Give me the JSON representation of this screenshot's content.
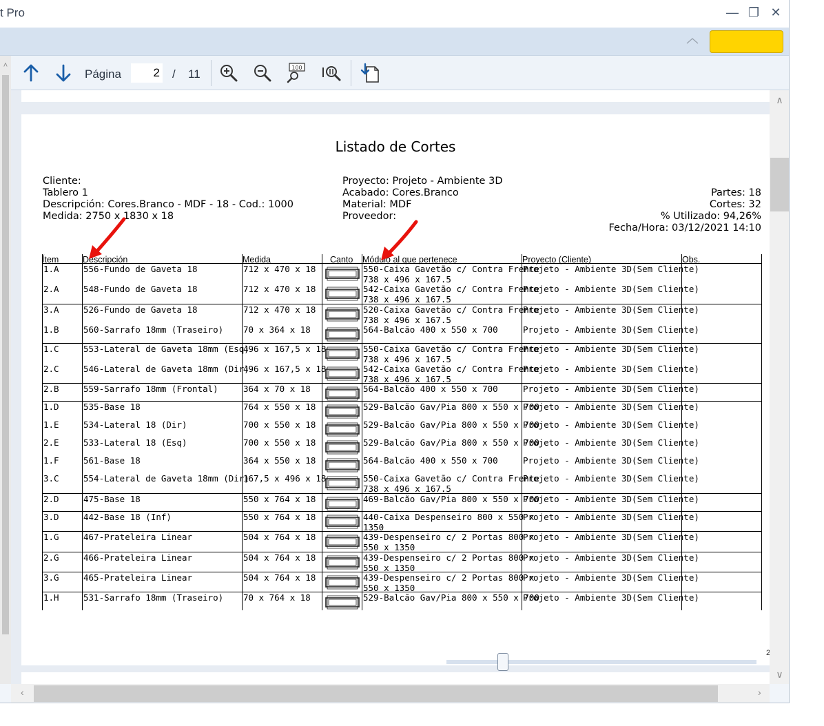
{
  "window": {
    "title": "t Pro"
  },
  "window_controls": {
    "minimize": "—",
    "maximize": "❐",
    "close": "✕"
  },
  "ribbon": {
    "collapse_icon": "chevron-up-icon",
    "accent_color": "#FFD400"
  },
  "toolbar": {
    "prev_icon": "arrow-up-icon",
    "next_icon": "arrow-down-icon",
    "page_label": "Página",
    "page_current": "2",
    "page_sep": "/",
    "page_total": "11",
    "zoom_in_icon": "zoom-in-icon",
    "zoom_out_icon": "zoom-out-icon",
    "zoom_100_icon": "zoom-100-icon",
    "zoom_fit_icon": "zoom-fit-icon",
    "export_icon": "export-icon",
    "icon_color": "#1a5ea8"
  },
  "document": {
    "title": "Listado de Cortes",
    "left_header": [
      "Cliente:",
      "Tablero 1",
      "Descripción: Cores.Branco - MDF - 18 - Cod.: 1000",
      "Medida: 2750 x 1830 x 18"
    ],
    "mid_header": [
      "Proyecto: Projeto - Ambiente 3D",
      "Acabado: Cores.Branco",
      "Material: MDF",
      "Proveedor:"
    ],
    "right_header": [
      "Partes: 18",
      "Cortes: 32",
      "% Utilizado: 94,26%",
      "Fecha/Hora: 03/12/2021 14:10"
    ],
    "columns": [
      "Ítem",
      "Descripción",
      "Medida",
      "Canto",
      "Módulo al que pertenece",
      "Proyecto (Cliente)",
      "Obs."
    ],
    "rows": [
      {
        "item": "1.A",
        "desc": "556-Fundo de Gaveta 18",
        "medida": "712 x 470 x 18",
        "modulo1": "550-Caixa Gavetão c/ Contra Frente",
        "modulo2": "738 x 496 x 167.5",
        "proyecto": "Projeto - Ambiente 3D(Sem Cliente)"
      },
      {
        "item": "2.A",
        "desc": "548-Fundo de Gaveta 18",
        "medida": "712 x 470 x 18",
        "modulo1": "542-Caixa Gavetão c/ Contra Frente",
        "modulo2": "738 x 496 x 167.5",
        "proyecto": "Projeto - Ambiente 3D(Sem Cliente)"
      },
      {
        "item": "3.A",
        "desc": "526-Fundo de Gaveta 18",
        "medida": "712 x 470 x 18",
        "modulo1": "520-Caixa Gavetão c/ Contra Frente",
        "modulo2": "738 x 496 x 167.5",
        "proyecto": "Projeto - Ambiente 3D(Sem Cliente)"
      },
      {
        "item": "1.B",
        "desc": "560-Sarrafo 18mm (Traseiro)",
        "medida": "70 x 364 x 18",
        "modulo1": "564-Balcão 400 x 550 x 700",
        "modulo2": "",
        "proyecto": "Projeto - Ambiente 3D(Sem Cliente)"
      },
      {
        "item": "1.C",
        "desc": "553-Lateral de Gaveta 18mm (Esq)",
        "medida": "496 x 167,5 x 18",
        "modulo1": "550-Caixa Gavetão c/ Contra Frente",
        "modulo2": "738 x 496 x 167.5",
        "proyecto": "Projeto - Ambiente 3D(Sem Cliente)"
      },
      {
        "item": "2.C",
        "desc": "546-Lateral de Gaveta 18mm (Dir)",
        "medida": "496 x 167,5 x 18",
        "modulo1": "542-Caixa Gavetão c/ Contra Frente",
        "modulo2": "738 x 496 x 167.5",
        "proyecto": "Projeto - Ambiente 3D(Sem Cliente)"
      },
      {
        "item": "2.B",
        "desc": "559-Sarrafo 18mm (Frontal)",
        "medida": "364 x 70 x 18",
        "modulo1": "564-Balcão 400 x 550 x 700",
        "modulo2": "",
        "proyecto": "Projeto - Ambiente 3D(Sem Cliente)"
      },
      {
        "item": "1.D",
        "desc": "535-Base 18",
        "medida": "764 x 550 x 18",
        "modulo1": "529-Balcão Gav/Pia 800 x 550 x 700",
        "modulo2": "",
        "proyecto": "Projeto - Ambiente 3D(Sem Cliente)"
      },
      {
        "item": "1.E",
        "desc": "534-Lateral 18 (Dir)",
        "medida": "700 x 550 x 18",
        "modulo1": "529-Balcão Gav/Pia 800 x 550 x 700",
        "modulo2": "",
        "proyecto": "Projeto - Ambiente 3D(Sem Cliente)"
      },
      {
        "item": "2.E",
        "desc": "533-Lateral 18 (Esq)",
        "medida": "700 x 550 x 18",
        "modulo1": "529-Balcão Gav/Pia 800 x 550 x 700",
        "modulo2": "",
        "proyecto": "Projeto - Ambiente 3D(Sem Cliente)"
      },
      {
        "item": "1.F",
        "desc": "561-Base 18",
        "medida": "364 x 550 x 18",
        "modulo1": "564-Balcão 400 x 550 x 700",
        "modulo2": "",
        "proyecto": "Projeto - Ambiente 3D(Sem Cliente)"
      },
      {
        "item": "3.C",
        "desc": "554-Lateral de Gaveta 18mm (Dir)",
        "medida": "167,5 x 496 x 18",
        "modulo1": "550-Caixa Gavetão c/ Contra Frente",
        "modulo2": "738 x 496 x 167.5",
        "proyecto": "Projeto - Ambiente 3D(Sem Cliente)"
      },
      {
        "item": "2.D",
        "desc": "475-Base 18",
        "medida": "550 x 764 x 18",
        "modulo1": "469-Balcão Gav/Pia 800 x 550 x 700",
        "modulo2": "",
        "proyecto": "Projeto - Ambiente 3D(Sem Cliente)"
      },
      {
        "item": "3.D",
        "desc": "442-Base 18 (Inf)",
        "medida": "550 x 764 x 18",
        "modulo1": "440-Caixa Despenseiro 800 x 550 x",
        "modulo2": "1350",
        "proyecto": "Projeto - Ambiente 3D(Sem Cliente)"
      },
      {
        "item": "1.G",
        "desc": "467-Prateleira Linear",
        "medida": "504 x 764 x 18",
        "modulo1": "439-Despenseiro c/ 2 Portas 800 x",
        "modulo2": "550 x 1350",
        "proyecto": "Projeto - Ambiente 3D(Sem Cliente)"
      },
      {
        "item": "2.G",
        "desc": "466-Prateleira Linear",
        "medida": "504 x 764 x 18",
        "modulo1": "439-Despenseiro c/ 2 Portas 800 x",
        "modulo2": "550 x 1350",
        "proyecto": "Projeto - Ambiente 3D(Sem Cliente)"
      },
      {
        "item": "3.G",
        "desc": "465-Prateleira Linear",
        "medida": "504 x 764 x 18",
        "modulo1": "439-Despenseiro c/ 2 Portas 800 x",
        "modulo2": "550 x 1350",
        "proyecto": "Projeto - Ambiente 3D(Sem Cliente)"
      },
      {
        "item": "1.H",
        "desc": "531-Sarrafo 18mm (Traseiro)",
        "medida": "70 x 764 x 18",
        "modulo1": "529-Balcão Gav/Pia 800 x 550 x 700",
        "modulo2": "",
        "proyecto": "Projeto - Ambiente 3D(Sem Cliente)"
      }
    ]
  },
  "annotations": {
    "arrow_color": "#E8120C"
  },
  "scroll": {
    "left_up": "˄",
    "up": "∧",
    "down": "∨",
    "left": "‹",
    "right": "›"
  },
  "zoom_slider": {
    "tick_label": "2"
  }
}
